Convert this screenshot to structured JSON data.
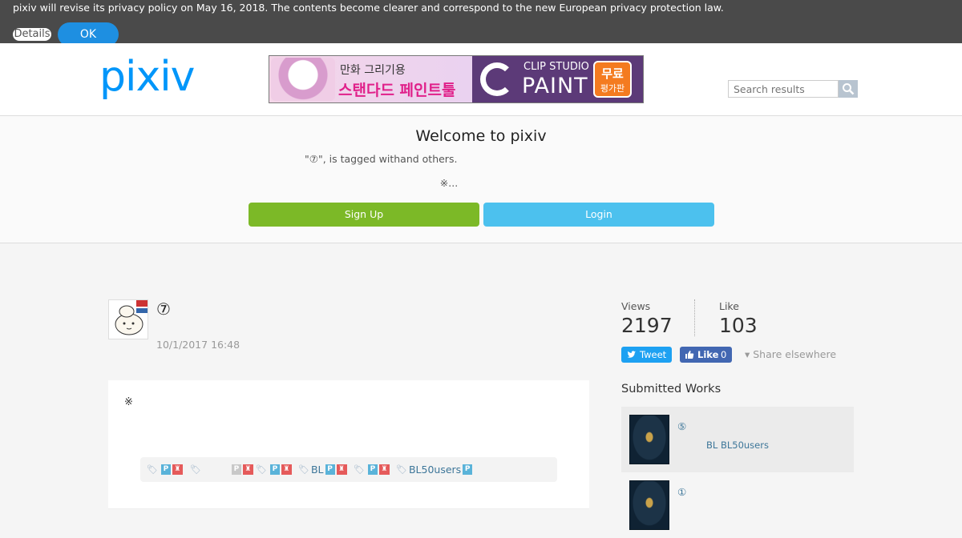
{
  "privacy": {
    "text": "pixiv will revise its privacy policy on May 16, 2018. The contents become clearer and correspond to the new European privacy protection law.",
    "details_label": "Details",
    "ok_label": "OK"
  },
  "header": {
    "logo": "pixiv",
    "ad": {
      "line1": "만화 그리기용",
      "line2": "스탠다드 페인트툴",
      "clip": "CLIP STUDIO",
      "paint": "PAINT",
      "badge1": "무료",
      "badge2": "평가판"
    },
    "search_placeholder": "Search results"
  },
  "welcome": {
    "title": "Welcome to pixiv",
    "desc": "\"⑦\", is tagged withand others.",
    "note": "※...",
    "signup_label": "Sign Up",
    "login_label": "Login"
  },
  "work": {
    "title": "⑦",
    "date": "10/1/2017 16:48",
    "caption": "※",
    "tags": [
      {
        "text": "",
        "badges": [
          "P",
          "R"
        ]
      },
      {
        "text": "",
        "badges": [
          "Pg",
          "R"
        ]
      },
      {
        "text": "",
        "badges": [
          "P",
          "R"
        ]
      },
      {
        "text": "BL",
        "badges": [
          "P",
          "R"
        ]
      },
      {
        "text": "",
        "badges": [
          "P",
          "R"
        ]
      },
      {
        "text": "BL50users",
        "badges": [
          "P"
        ]
      }
    ]
  },
  "stats": {
    "views_label": "Views",
    "views": "2197",
    "like_label": "Like",
    "likes": "103",
    "tweet_label": "Tweet",
    "fb_like_label": "Like",
    "fb_like_count": "0",
    "share_label": "▾ Share elsewhere"
  },
  "submitted": {
    "title": "Submitted Works",
    "items": [
      {
        "title": "⑤",
        "tags": "BL  BL50users"
      },
      {
        "title": "①",
        "tags": ""
      }
    ]
  },
  "colors": {
    "brand": "#0096fa",
    "signup": "#7cb927",
    "login": "#4cc1ee",
    "tweet": "#1da1f2",
    "fb": "#4267b2"
  }
}
